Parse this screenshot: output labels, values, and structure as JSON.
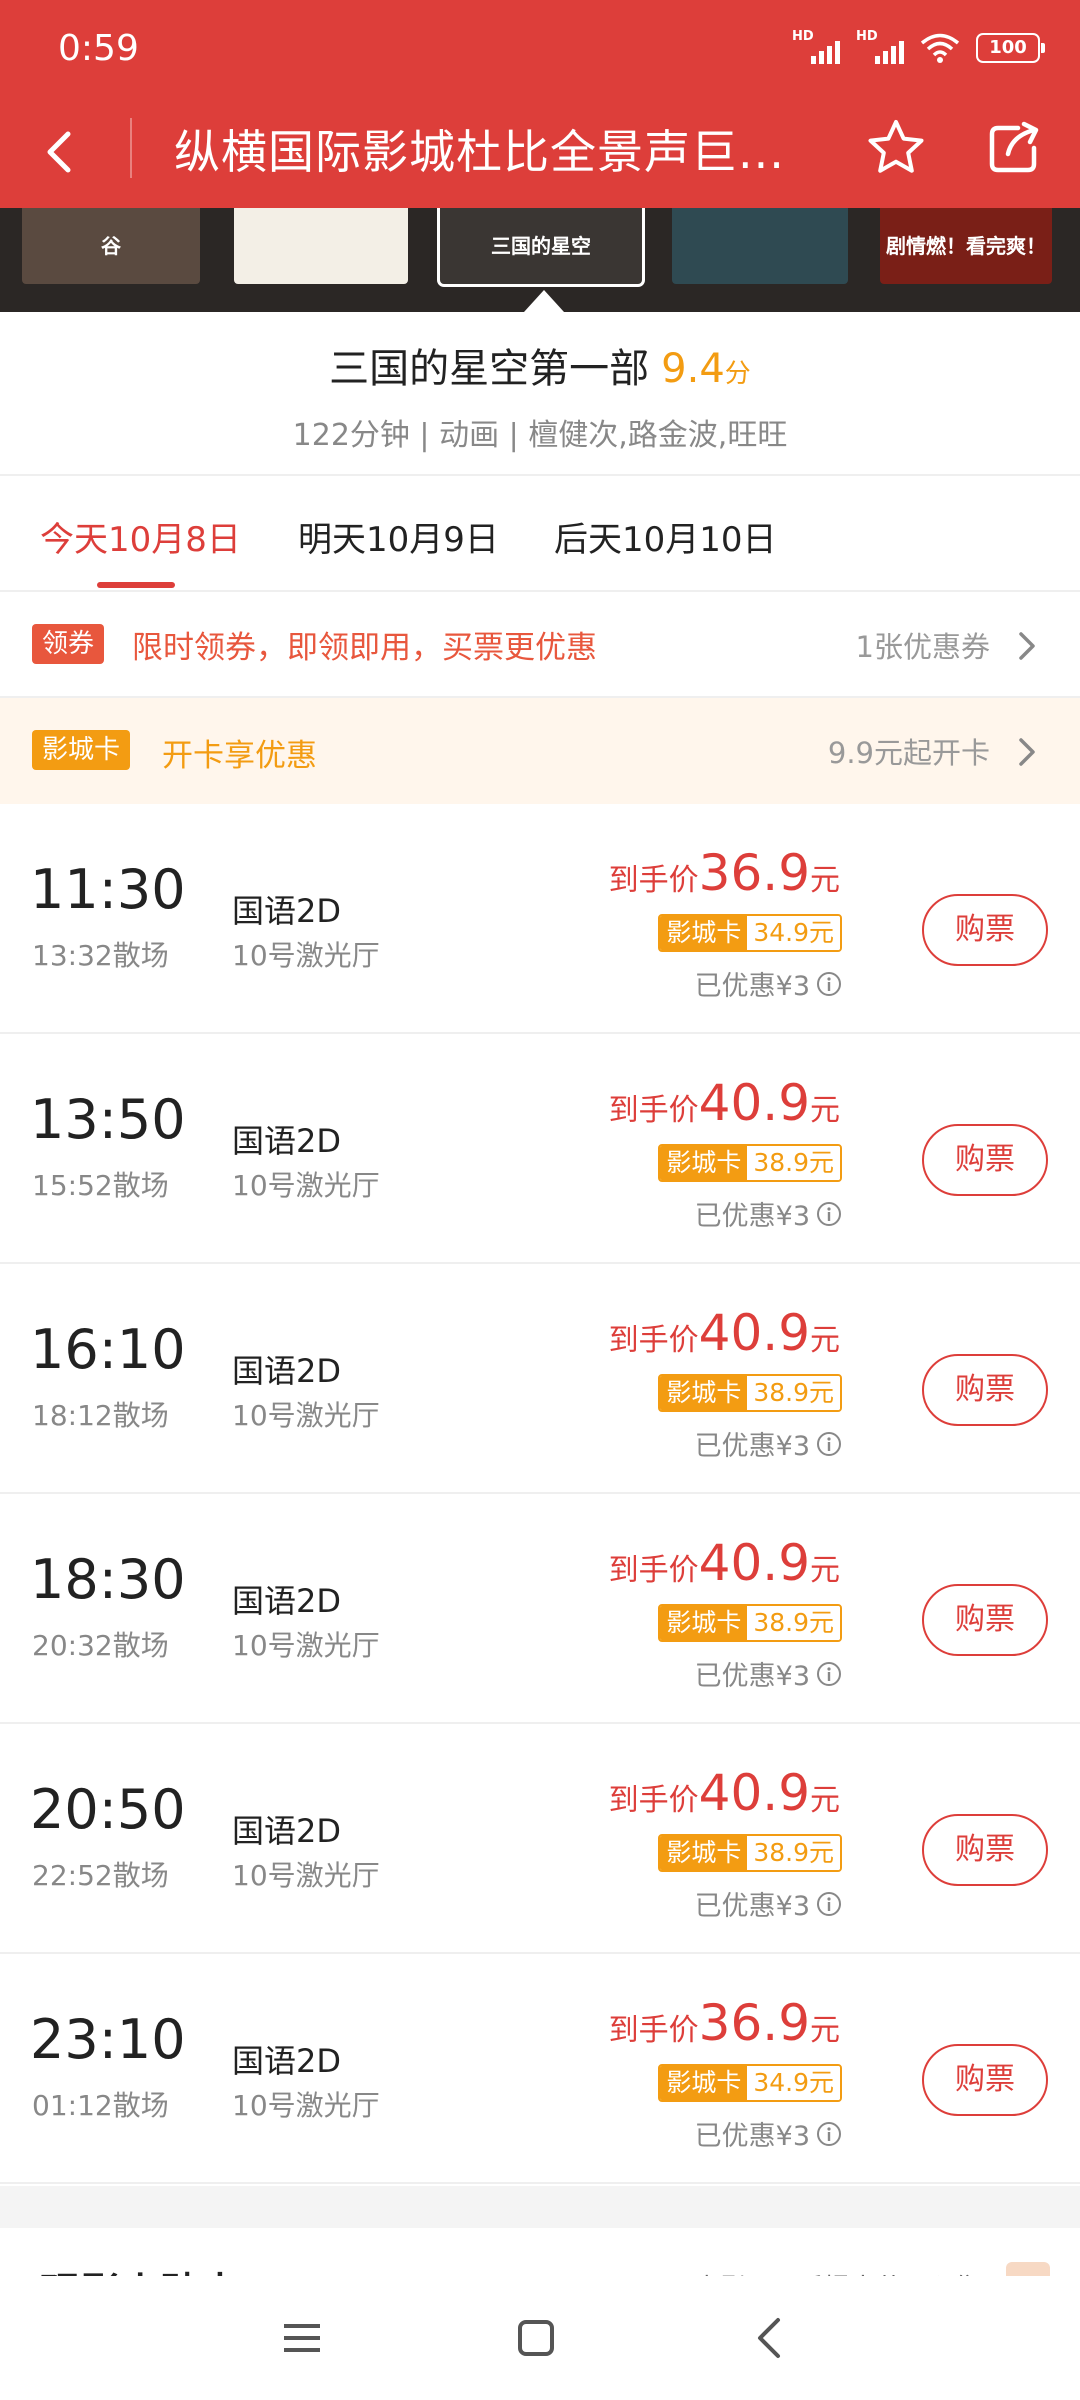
{
  "status": {
    "time": "0:59",
    "battery": "100",
    "hd1": "HD",
    "hd2": "HD"
  },
  "nav": {
    "title": "纵横国际影城杜比全景声巨..."
  },
  "posters": [
    {
      "label": "谷",
      "color": "#5a4a40"
    },
    {
      "label": "",
      "color": "#f3efe6"
    },
    {
      "label": "三国的星空",
      "color": "#3a3633"
    },
    {
      "label": "",
      "color": "#2f4a52"
    },
    {
      "label": "剧情燃！看完爽！",
      "color": "#7a1f17"
    }
  ],
  "movie": {
    "title": "三国的星空第一部",
    "score": "9.4",
    "score_unit": "分",
    "meta": "122分钟 | 动画 | 檀健次,路金波,旺旺"
  },
  "date_tabs": [
    {
      "label": "今天10月8日",
      "active": true
    },
    {
      "label": "明天10月9日",
      "active": false
    },
    {
      "label": "后天10月10日",
      "active": false
    }
  ],
  "coupon": {
    "badge": "领券",
    "text": "限时领券，即领即用，买票更优惠",
    "count": "1张优惠券"
  },
  "cinema_card": {
    "badge": "影城卡",
    "text": "开卡享优惠",
    "price": "9.9元起开卡"
  },
  "price_labels": {
    "prefix": "到手价",
    "unit": "元",
    "card_label": "影城卡",
    "buy": "购票"
  },
  "showtimes": [
    {
      "start": "11:30",
      "end": "13:32散场",
      "lang": "国语2D",
      "hall": "10号激光厅",
      "price": "36.9",
      "card_price": "34.9元",
      "discount": "已优惠¥3"
    },
    {
      "start": "13:50",
      "end": "15:52散场",
      "lang": "国语2D",
      "hall": "10号激光厅",
      "price": "40.9",
      "card_price": "38.9元",
      "discount": "已优惠¥3"
    },
    {
      "start": "16:10",
      "end": "18:12散场",
      "lang": "国语2D",
      "hall": "10号激光厅",
      "price": "40.9",
      "card_price": "38.9元",
      "discount": "已优惠¥3"
    },
    {
      "start": "18:30",
      "end": "20:32散场",
      "lang": "国语2D",
      "hall": "10号激光厅",
      "price": "40.9",
      "card_price": "38.9元",
      "discount": "已优惠¥3"
    },
    {
      "start": "20:50",
      "end": "22:52散场",
      "lang": "国语2D",
      "hall": "10号激光厅",
      "price": "40.9",
      "card_price": "38.9元",
      "discount": "已优惠¥3"
    },
    {
      "start": "23:10",
      "end": "01:12散场",
      "lang": "国语2D",
      "hall": "10号激光厅",
      "price": "36.9",
      "card_price": "34.9元",
      "discount": "已优惠¥3"
    }
  ],
  "tips": {
    "title": "观影小贴士",
    "right_text": "电影开画后提出节目预售"
  },
  "colors": {
    "brand_red": "#dd3e3a",
    "card_orange": "#f39c12",
    "coupon_orange": "#e8573d"
  }
}
